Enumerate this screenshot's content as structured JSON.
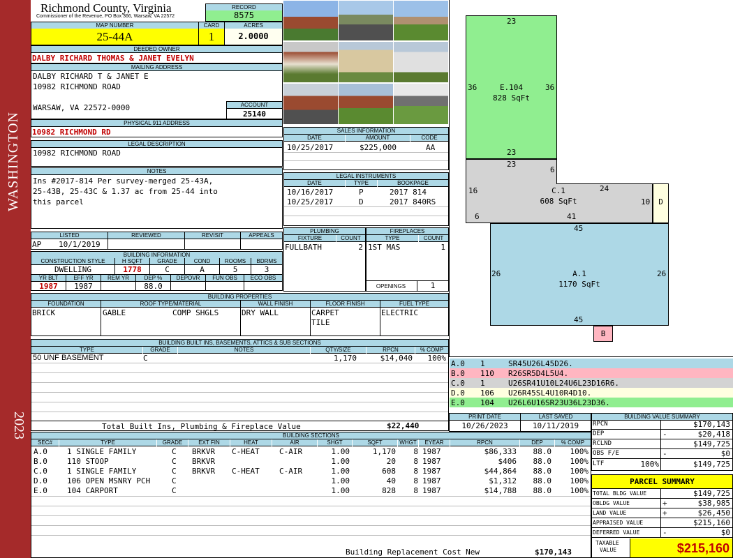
{
  "sidebar": {
    "district": "WASHINGTON",
    "year": "2023"
  },
  "county": {
    "name": "Richmond County, Virginia",
    "address": "Commissioner of the Revenue, PO Box 366, Warsaw, VA 22572"
  },
  "record": {
    "label": "RECORD",
    "value": "8575"
  },
  "map": {
    "label": "MAP NUMBER",
    "value": "25-44A",
    "card_label": "CARD",
    "card": "1",
    "acres_label": "ACRES",
    "acres": "2.0000"
  },
  "owner": {
    "label": "DEEDED OWNER",
    "value": "DALBY RICHARD THOMAS & JANET EVELYN"
  },
  "mailing": {
    "label": "MAILING ADDRESS",
    "line1": "DALBY RICHARD T & JANET E",
    "line2": "10982 RICHMOND ROAD",
    "line3": "WARSAW, VA 22572-0000"
  },
  "account": {
    "label": "ACCOUNT",
    "value": "25140"
  },
  "physical": {
    "label": "PHYSICAL 911 ADDRESS",
    "value": "10982 RICHMOND RD"
  },
  "legal": {
    "label": "LEGAL DESCRIPTION",
    "value": "10982 RICHMOND ROAD"
  },
  "notes": {
    "label": "NOTES",
    "line1": "Ins #2017-814 Per survey-merged 25-43A,",
    "line2": "25-43B, 25-43C & 1.37 ac from 25-44 into",
    "line3": "this parcel"
  },
  "review": {
    "listed_label": "LISTED",
    "reviewed_label": "REVIEWED",
    "revisit_label": "REVISIT",
    "appeals_label": "APPEALS",
    "listed_by": "AP",
    "listed_date": "10/1/2019"
  },
  "building_info": {
    "label": "BUILDING INFORMATION",
    "h": [
      "CONSTRUCTION STYLE",
      "H SQFT",
      "GRADE",
      "COND",
      "ROOMS",
      "BDRMS"
    ],
    "style": "DWELLING",
    "hsqft": "1778",
    "grade": "C",
    "cond": "A",
    "rooms": "5",
    "bdrms": "3",
    "h2": [
      "YR BLT",
      "EFF YR",
      "REM YR",
      "DEP %",
      "DEPOVR",
      "FUN OBS",
      "ECO OBS"
    ],
    "yrblt": "1987",
    "effyr": "1987",
    "dep": "88.0"
  },
  "sales": {
    "label": "SALES INFORMATION",
    "h": [
      "DATE",
      "AMOUNT",
      "CODE"
    ],
    "date": "10/25/2017",
    "amount": "$225,000",
    "code": "AA"
  },
  "legal_inst": {
    "label": "LEGAL INSTRUMENTS",
    "h": [
      "DATE",
      "TYPE",
      "BOOKPAGE"
    ],
    "rows": [
      {
        "date": "10/16/2017",
        "type": "P",
        "book": "2017 814"
      },
      {
        "date": "10/25/2017",
        "type": "D",
        "book": "2017 840RS"
      }
    ]
  },
  "plumbing": {
    "label": "PLUMBING",
    "h": [
      "FIXTURE",
      "COUNT"
    ],
    "fixture": "FULLBATH",
    "count": "2"
  },
  "fireplaces": {
    "label": "FIREPLACES",
    "h": [
      "TYPE",
      "COUNT"
    ],
    "type": "1ST MAS",
    "count": "1",
    "openings_label": "OPENINGS",
    "openings": "1"
  },
  "bldg_props": {
    "label": "BUILDING PROPERTIES",
    "h": [
      "FOUNDATION",
      "ROOF TYPE/MATERIAL",
      "WALL FINISH",
      "FLOOR FINISH",
      "FUEL TYPE"
    ],
    "foundation": "BRICK",
    "roof1": "GABLE",
    "roof2": "COMP SHGLS",
    "wall": "DRY WALL",
    "floor1": "CARPET",
    "floor2": "TILE",
    "fuel": "ELECTRIC"
  },
  "builtins": {
    "label": "BUILDING BUILT INS, BASEMENTS, ATTICS & SUB SECTIONS",
    "h": [
      "TYPE",
      "GRADE",
      "NOTES",
      "QTY/SIZE",
      "RPCN",
      "% COMP"
    ],
    "type": "50 UNF BASEMENT",
    "grade": "C",
    "qty": "1,170",
    "rpcn": "$14,040",
    "comp": "100%",
    "total_label": "Total Built Ins, Plumbing & Fireplace Value",
    "total": "$22,440"
  },
  "print": {
    "print_label": "PRINT DATE",
    "saved_label": "LAST SAVED",
    "print_date": "10/26/2023",
    "saved_date": "10/11/2019"
  },
  "sections": {
    "label": "BUILDING SECTIONS",
    "h": [
      "SEC#",
      "TYPE",
      "GRADE",
      "EXT FIN",
      "HEAT",
      "AIR",
      "SHGT",
      "SQFT",
      "WHGT",
      "EYEAR",
      "RPCN",
      "DEP",
      "% COMP"
    ],
    "rows": [
      {
        "sec": "A.0",
        "type": "1 SINGLE FAMILY",
        "grade": "C",
        "ext": "BRKVR",
        "heat": "C-HEAT",
        "air": "C-AIR",
        "shgt": "1.00",
        "sqft": "1,170",
        "whgt": "8",
        "eyear": "1987",
        "rpcn": "$86,333",
        "dep": "88.0",
        "comp": "100%"
      },
      {
        "sec": "B.0",
        "type": "110 STOOP",
        "grade": "C",
        "ext": "BRKVR",
        "heat": "",
        "air": "",
        "shgt": "1.00",
        "sqft": "20",
        "whgt": "8",
        "eyear": "1987",
        "rpcn": "$406",
        "dep": "88.0",
        "comp": "100%"
      },
      {
        "sec": "C.0",
        "type": "1 SINGLE FAMILY",
        "grade": "C",
        "ext": "BRKVR",
        "heat": "C-HEAT",
        "air": "C-AIR",
        "shgt": "1.00",
        "sqft": "608",
        "whgt": "8",
        "eyear": "1987",
        "rpcn": "$44,864",
        "dep": "88.0",
        "comp": "100%"
      },
      {
        "sec": "D.0",
        "type": "106 OPEN MSNRY PCH",
        "grade": "C",
        "ext": "",
        "heat": "",
        "air": "",
        "shgt": "1.00",
        "sqft": "40",
        "whgt": "8",
        "eyear": "1987",
        "rpcn": "$1,312",
        "dep": "88.0",
        "comp": "100%"
      },
      {
        "sec": "E.0",
        "type": "104 CARPORT",
        "grade": "C",
        "ext": "",
        "heat": "",
        "air": "",
        "shgt": "1.00",
        "sqft": "828",
        "whgt": "8",
        "eyear": "1987",
        "rpcn": "$14,788",
        "dep": "88.0",
        "comp": "100%"
      }
    ],
    "brcn_label": "Building Replacement Cost New",
    "brcn": "$170,143"
  },
  "sketch": {
    "e_label": "E.104",
    "e_area": "828 SqFt",
    "c_label": "C.1",
    "c_area": "608 SqFt",
    "a_label": "A.1",
    "a_area": "1170 SqFt",
    "d_label": "D",
    "b_label": "B",
    "dims": {
      "e_top": "23",
      "e_left": "36",
      "e_right": "36",
      "e_bot": "23",
      "c_top": "23",
      "c_6a": "6",
      "c_24": "24",
      "c_16": "16",
      "c_10": "10",
      "c_6b": "6",
      "c_41": "41",
      "a_top": "45",
      "a_left": "26",
      "a_right": "26",
      "a_bot": "45"
    }
  },
  "segments": [
    {
      "code": "A.0",
      "id": "1",
      "path": "SR45U26L45D26.",
      "color": "#add8e6"
    },
    {
      "code": "B.0",
      "id": "110",
      "path": "R26SR5D4L5U4.",
      "color": "#ffb6c1"
    },
    {
      "code": "C.0",
      "id": "1",
      "path": "U26SR41U10L24U6L23D16R6.",
      "color": "#d3d3d3"
    },
    {
      "code": "D.0",
      "id": "106",
      "path": "U26R45SL4U10R4D10.",
      "color": "#ffffe0"
    },
    {
      "code": "E.0",
      "id": "104",
      "path": "U26L6U16SR23U36L23D36.",
      "color": "#90ee90"
    }
  ],
  "bvs": {
    "label": "BUILDING VALUE SUMMARY",
    "rows": [
      {
        "k": "RPCN",
        "sign": "",
        "v": "$170,143"
      },
      {
        "k": "DEP",
        "sign": "-",
        "v": "$20,418"
      },
      {
        "k": "RCLND",
        "sign": "",
        "v": "$149,725"
      },
      {
        "k": "OBS F/E",
        "sign": "-",
        "v": "$0"
      },
      {
        "k": "LTF",
        "pct": "100%",
        "sign": "",
        "v": "$149,725"
      }
    ]
  },
  "parcel": {
    "label": "PARCEL SUMMARY",
    "rows": [
      {
        "k": "TOTAL BLDG VALUE",
        "sign": "",
        "v": "$149,725"
      },
      {
        "k": "OBLDG VALUE",
        "sign": "+",
        "v": "$38,985"
      },
      {
        "k": "LAND VALUE",
        "sign": "+",
        "v": "$26,450"
      },
      {
        "k": "APPRAISED VALUE",
        "sign": "",
        "v": "$215,160"
      },
      {
        "k": "DEFERRED VALUE",
        "sign": "-",
        "v": "$0"
      }
    ],
    "taxable_label1": "TAXABLE",
    "taxable_label2": "VALUE",
    "taxable": "$215,160"
  }
}
